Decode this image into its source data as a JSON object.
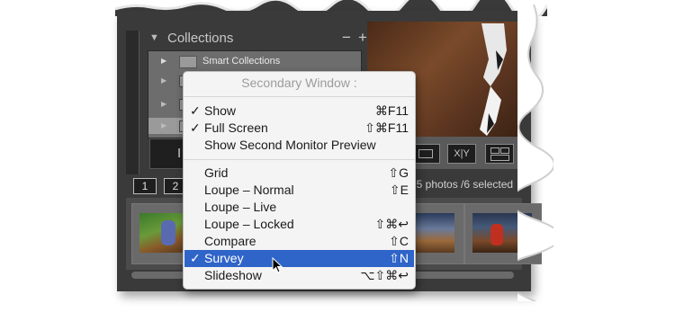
{
  "collections_panel": {
    "title": "Collections",
    "minus": "−",
    "plus": "+",
    "smart_collections": "Smart Collections"
  },
  "import_button_partial": "I",
  "filmstrip": {
    "pages": [
      "1",
      "2"
    ],
    "status_partial": "15 photos /6 selected"
  },
  "toolbar": {
    "xy_label": "X|Y"
  },
  "menu": {
    "title": "Secondary Window :",
    "items": [
      {
        "label": "Show",
        "shortcut": "⌘F11",
        "checked": "✓"
      },
      {
        "label": "Full Screen",
        "shortcut": "⇧⌘F11",
        "checked": "✓"
      },
      {
        "label": "Show Second Monitor Preview",
        "shortcut": "",
        "checked": ""
      },
      {
        "label": "Grid",
        "shortcut": "⇧G",
        "checked": ""
      },
      {
        "label": "Loupe – Normal",
        "shortcut": "⇧E",
        "checked": ""
      },
      {
        "label": "Loupe – Live",
        "shortcut": "",
        "checked": ""
      },
      {
        "label": "Loupe – Locked",
        "shortcut": "⇧⌘↩",
        "checked": ""
      },
      {
        "label": "Compare",
        "shortcut": "⇧C",
        "checked": ""
      },
      {
        "label": "Survey",
        "shortcut": "⇧N",
        "checked": "✓"
      },
      {
        "label": "Slideshow",
        "shortcut": "⌥⇧⌘↩",
        "checked": ""
      }
    ],
    "highlighted": "Survey"
  },
  "colors": {
    "highlight": "#2f64c8",
    "panel_dark": "#3a3a3a"
  }
}
